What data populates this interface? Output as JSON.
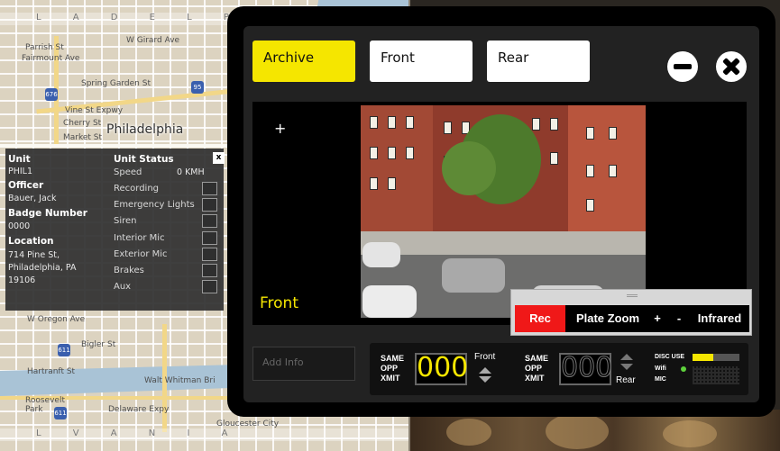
{
  "map": {
    "city": "Philadelphia",
    "edge_letters_top": "L A D E L P",
    "edge_letters_bottom": "L V A N I A",
    "street_labels": [
      "Parrish St",
      "Fairmount Ave",
      "Spring Garden St",
      "W Girard Ave",
      "Vine St Expwy",
      "Cherry St",
      "Market St",
      "W Oregon Ave",
      "Bigler St",
      "Hartranft St",
      "Walt Whitman Bri",
      "Delaware Expy",
      "Roosevelt Park",
      "Gloucester City"
    ],
    "shields": [
      "676",
      "611",
      "95",
      "611"
    ]
  },
  "unit_panel": {
    "close_label": "x",
    "unit_label": "Unit",
    "unit_value": "PHIL1",
    "officer_label": "Officer",
    "officer_value": "Bauer, Jack",
    "badge_label": "Badge Number",
    "badge_value": "0000",
    "location_label": "Location",
    "location_lines": [
      "714 Pine St,",
      "Philadelphia, PA",
      "19106"
    ],
    "status_label": "Unit Status",
    "speed_label": "Speed",
    "speed_value": "0 KMH",
    "status_items": [
      "Recording",
      "Emergency Lights",
      "Siren",
      "Interior Mic",
      "Exterior Mic",
      "Brakes",
      "Aux"
    ]
  },
  "window": {
    "tabs": {
      "archive": "Archive",
      "front": "Front",
      "rear": "Rear"
    },
    "video": {
      "add_symbol": "+",
      "caption": "Front"
    },
    "controls": {
      "rec": "Rec",
      "plate_zoom": "Plate Zoom",
      "zoom_in": "+",
      "zoom_out": "-",
      "infrared": "Infrared"
    },
    "add_info_placeholder": "Add Info",
    "xmit": {
      "front": {
        "same": "SAME",
        "opp": "OPP",
        "xmit": "XMIT",
        "count": "000",
        "label": "Front"
      },
      "rear": {
        "same": "SAME",
        "opp": "OPP",
        "xmit": "XMIT",
        "count": "000",
        "label": "Rear"
      }
    },
    "status": {
      "disc_label": "DISC USE",
      "disc_use_fraction": 0.45,
      "wifi_label": "Wifi",
      "mic_label": "MIC"
    },
    "colors": {
      "accent_yellow": "#f5e600",
      "rec_red": "#f01818",
      "wifi_green": "#5ed23c"
    }
  }
}
